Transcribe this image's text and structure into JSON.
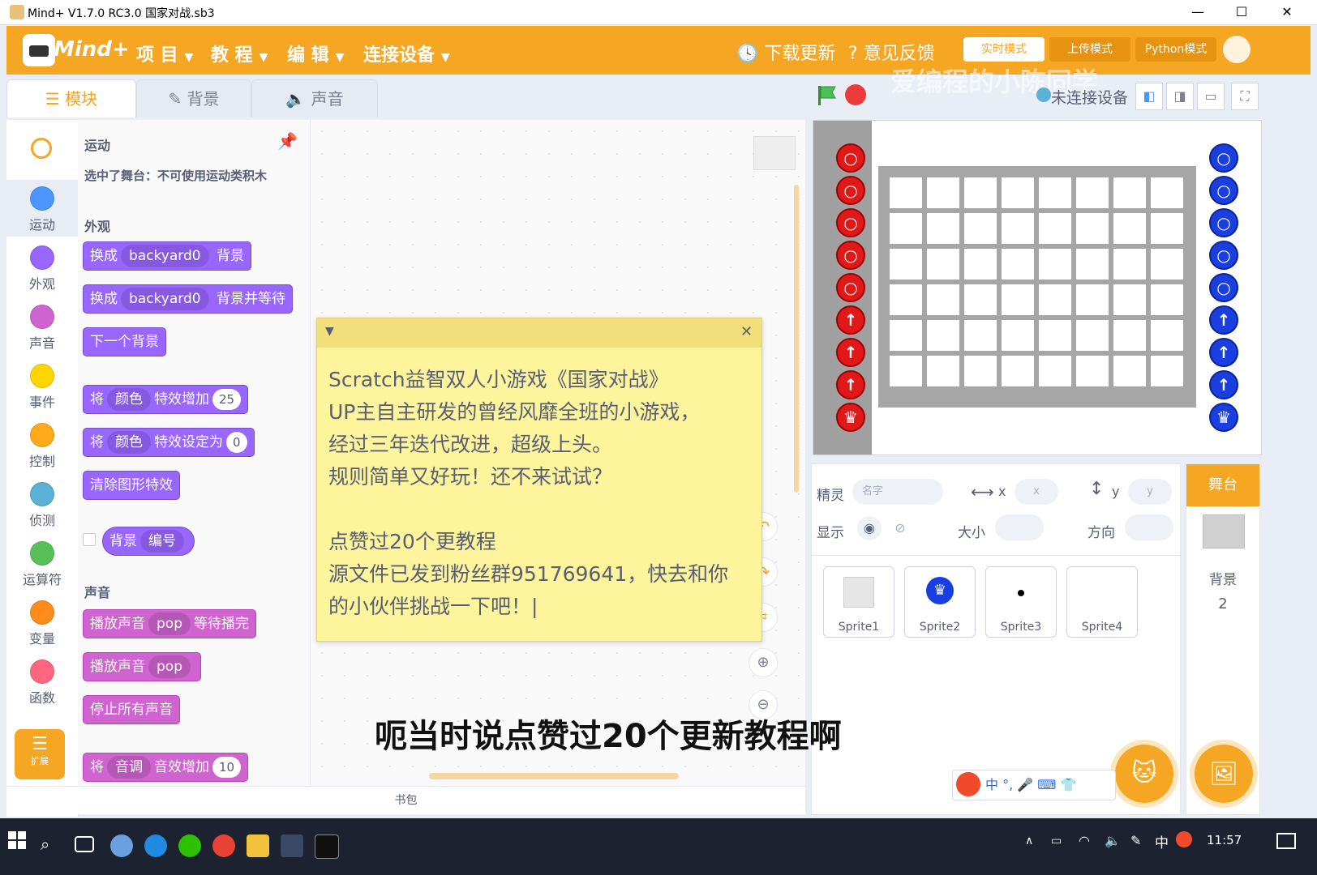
{
  "window": {
    "title": "Mind+ V1.7.0 RC3.0    国家对战.sb3",
    "minimize": "—",
    "maximize": "☐",
    "close": "✕"
  },
  "menubar": {
    "logo": "Mind+",
    "items": [
      {
        "label": "项 目"
      },
      {
        "label": "教 程"
      },
      {
        "label": "编 辑"
      },
      {
        "label": "连接设备"
      }
    ],
    "download_update": "下载更新",
    "feedback": "意见反馈",
    "mode_button": "实时模式",
    "mode_button_2": "上传模式",
    "python_mode": "Python模式"
  },
  "tabs": [
    {
      "label": "模块"
    },
    {
      "label": "背景"
    },
    {
      "label": "声音"
    }
  ],
  "categories": [
    {
      "label": "运动",
      "color": "#4c97ff"
    },
    {
      "label": "外观",
      "color": "#9966ff"
    },
    {
      "label": "声音",
      "color": "#cf63cf"
    },
    {
      "label": "事件",
      "color": "#ffd500"
    },
    {
      "label": "控制",
      "color": "#ffab19"
    },
    {
      "label": "侦测",
      "color": "#5cb1d6"
    },
    {
      "label": "运算符",
      "color": "#59c059"
    },
    {
      "label": "变量",
      "color": "#ff8c1a"
    },
    {
      "label": "函数",
      "color": "#ff6680"
    }
  ],
  "extension_label": "扩展",
  "palette": {
    "motion_title": "运动",
    "motion_notice": "选中了舞台：不可使用运动类积木",
    "looks_title": "外观",
    "sound_title": "声音",
    "blocks": {
      "switch_backdrop": {
        "prefix": "换成",
        "value": "backyard0",
        "suffix": "背景"
      },
      "switch_backdrop_wait": {
        "prefix": "换成",
        "value": "backyard0",
        "suffix": "背景并等待"
      },
      "next_backdrop": "下一个背景",
      "change_effect": {
        "prefix": "将",
        "value": "颜色",
        "suffix": "特效增加",
        "num": "25"
      },
      "set_effect": {
        "prefix": "将",
        "value": "颜色",
        "suffix": "特效设定为",
        "num": "0"
      },
      "clear_effects": "清除图形特效",
      "backdrop_reporter": {
        "prefix": "背景",
        "value": "编号"
      },
      "play_sound_wait": {
        "prefix": "播放声音",
        "value": "pop",
        "suffix": "等待播完"
      },
      "play_sound": {
        "prefix": "播放声音",
        "value": "pop"
      },
      "stop_all_sounds": "停止所有声音",
      "change_pitch": {
        "prefix": "将",
        "value": "音调",
        "suffix": "音效增加",
        "num": "10"
      }
    }
  },
  "note": {
    "text": "Scratch益智双人小游戏《国家对战》\nUP主自主研发的曾经风靡全班的小游戏，\n经过三年迭代改进，超级上头。\n规则简单又好玩！还不来试试？\n\n点赞过20个更教程\n源文件已发到粉丝群951769641，快去和你\n的小伙伴挑战一下吧！|"
  },
  "backpack_label": "书包",
  "stage_header": {
    "connection_status": "未连接设备"
  },
  "sprite_info": {
    "sprite_label": "精灵",
    "name_placeholder": "名字",
    "x_label": "x",
    "x_placeholder": "x",
    "y_label": "y",
    "y_placeholder": "y",
    "show_label": "显示",
    "size_label": "大小",
    "direction_label": "方向"
  },
  "sprites": [
    {
      "name": "Sprite1"
    },
    {
      "name": "Sprite2"
    },
    {
      "name": "Sprite3"
    },
    {
      "name": "Sprite4"
    }
  ],
  "stage_selector": {
    "title": "舞台",
    "backdrop_label": "背景",
    "backdrop_count": "2"
  },
  "subtitle": "呃当时说点赞过20个更新教程啊",
  "watermark": "爱编程的小陈同学",
  "ime": {
    "lang": "中"
  },
  "taskbar": {
    "time": "11:57",
    "ime_lang": "中"
  },
  "colors": {
    "brand_orange": "#f5a623",
    "note_yellow": "#fef49c",
    "red_token": "#e01818",
    "blue_token": "#1a3fe0"
  }
}
